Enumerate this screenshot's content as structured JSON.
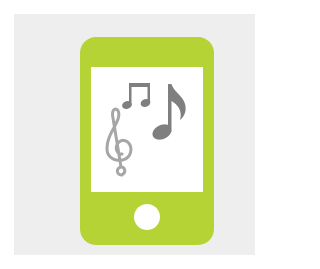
{
  "illustration": {
    "subject": "smartphone-with-music-notes",
    "icons": [
      "music-note-icon",
      "eighth-note-icon",
      "treble-clef-icon",
      "home-button-icon"
    ]
  },
  "colors": {
    "page_background": "#ffffff",
    "tile_background": "#eeeeee",
    "phone_body": "#b5d334",
    "screen": "#ffffff",
    "notes": "#7f7f7f",
    "clef": "#a6a6a6",
    "home_button": "#ffffff"
  }
}
